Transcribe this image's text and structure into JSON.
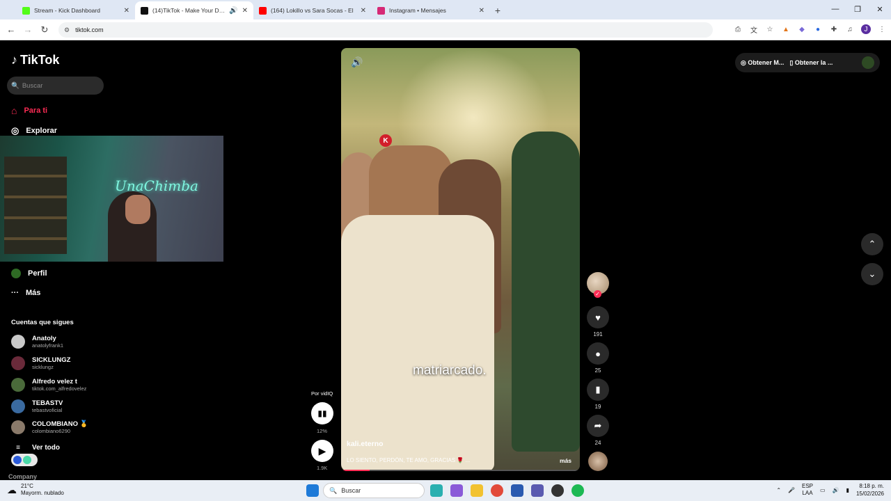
{
  "browser": {
    "tabs": [
      {
        "title": "Stream - Kick Dashboard",
        "color": "#53fc18",
        "active": false
      },
      {
        "title": "(14)TikTok - Make Your Day",
        "color": "#111111",
        "active": true
      },
      {
        "title": "(164) Lokillo vs Sara Socas - El",
        "color": "#ff0000",
        "active": false
      },
      {
        "title": "Instagram • Mensajes",
        "color": "#d62976",
        "active": false
      }
    ],
    "url": "tiktok.com"
  },
  "sidebar": {
    "logo": "TikTok",
    "search_placeholder": "Buscar",
    "nav": [
      {
        "label": "Para ti",
        "icon": "home-icon"
      },
      {
        "label": "Explorar",
        "icon": "compass-icon"
      },
      {
        "label": "Perfil",
        "icon": "profile-icon"
      },
      {
        "label": "Más",
        "icon": "more-icon"
      }
    ],
    "webcam_sign": "UnaChimba",
    "following_title": "Cuentas que sigues",
    "following": [
      {
        "name": "Anatoly",
        "handle": "anatolyfrank1",
        "color": "#c9c9c9"
      },
      {
        "name": "SICKLUNGZ",
        "handle": "sicklungz",
        "color": "#6a2a3a"
      },
      {
        "name": "Alfredo velez t",
        "handle": "tiktok.com_alfredovelez",
        "color": "#4a6a3a"
      },
      {
        "name": "TEBASTV",
        "handle": "tebastvoficial",
        "color": "#3a6aa0"
      },
      {
        "name": "COLOMBIANO 🥇",
        "handle": "colombiano6290",
        "color": "#8a7a6a"
      }
    ],
    "see_all": "Ver todo",
    "company": "Company"
  },
  "video": {
    "caption": "matriarcado.",
    "author": "kali.eterno",
    "description": "LO SIENTO, PERDÓN, TE AMO, GRACIAS 🌹 ...",
    "more": "más",
    "badge": "K",
    "progress": 0.12
  },
  "vidiq": {
    "label": "Por vidIQ",
    "percent": "12%",
    "plays": "1.9K"
  },
  "actions": {
    "likes": "191",
    "comments": "25",
    "saves": "19",
    "shares": "24"
  },
  "topright": {
    "get_coins": "Obtener M...",
    "get_app": "Obtener la ..."
  },
  "taskbar": {
    "temp": "21°C",
    "weather": "Mayorm. nublado",
    "search": "Buscar",
    "lang1": "ESP",
    "lang2": "LAA",
    "time": "8:18 p. m.",
    "date": "15/02/2026"
  }
}
